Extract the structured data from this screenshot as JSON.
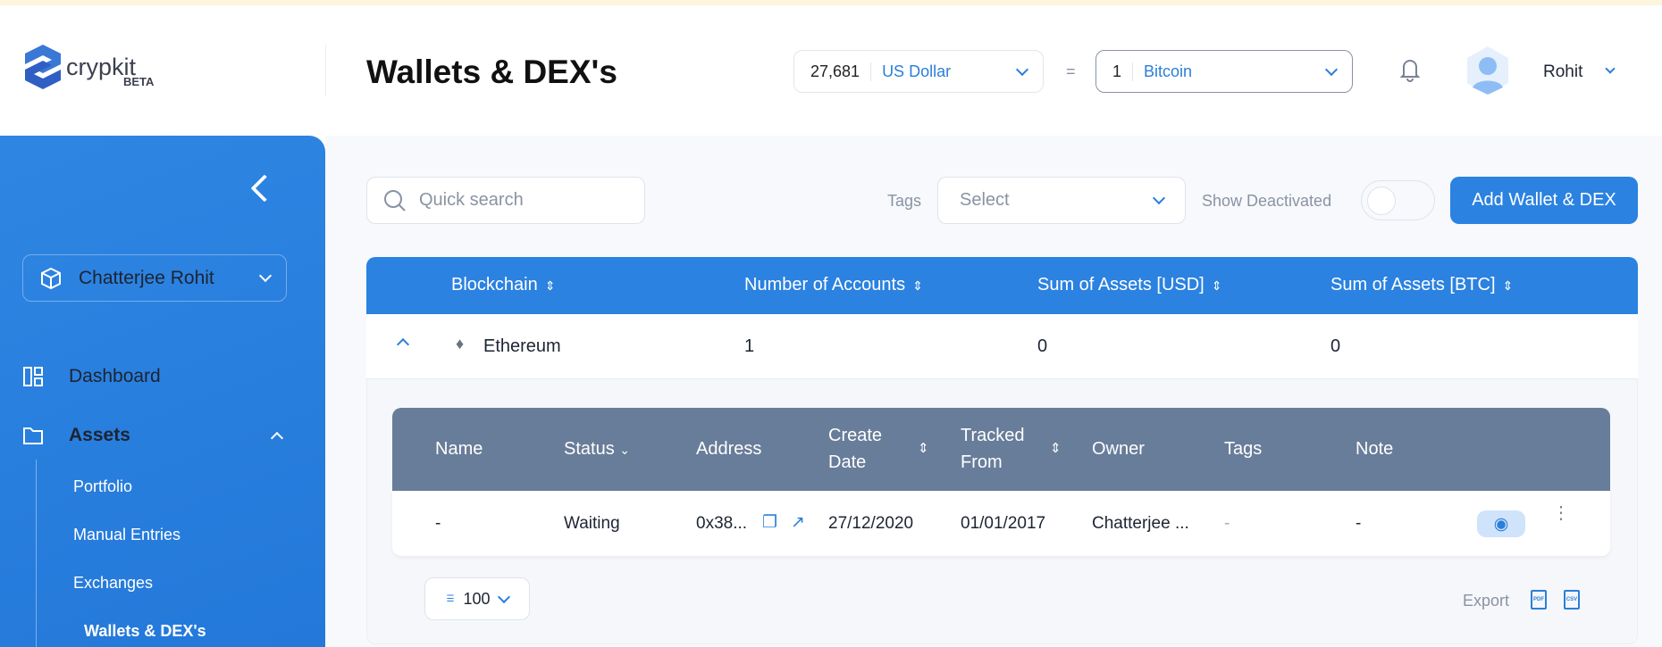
{
  "header": {
    "logo_text": "crypkit",
    "logo_badge": "BETA",
    "title": "Wallets & DEX's",
    "converter": {
      "from_amount": "27,681",
      "from_currency": "US Dollar",
      "equals": "=",
      "to_amount": "1",
      "to_currency": "Bitcoin"
    },
    "user_name": "Rohit"
  },
  "sidebar": {
    "org": "Chatterjee Rohit",
    "items": [
      {
        "label": "Dashboard"
      },
      {
        "label": "Assets"
      }
    ],
    "sub_items": [
      {
        "label": "Portfolio"
      },
      {
        "label": "Manual Entries"
      },
      {
        "label": "Exchanges"
      },
      {
        "label": "Wallets & DEX's"
      }
    ]
  },
  "toolbar": {
    "search_placeholder": "Quick search",
    "tags_label": "Tags",
    "tags_placeholder": "Select",
    "show_deactivated": "Show Deactivated",
    "show_deactivated_on": false,
    "add_button": "Add Wallet & DEX"
  },
  "table": {
    "columns": [
      "Blockchain",
      "Number of Accounts",
      "Sum of Assets [USD]",
      "Sum of Assets [BTC]"
    ],
    "rows": [
      {
        "blockchain": "Ethereum",
        "accounts": "1",
        "sum_usd": "0",
        "sum_btc": "0"
      }
    ]
  },
  "subtable": {
    "columns": {
      "name": "Name",
      "status": "Status",
      "address": "Address",
      "create1": "Create",
      "create2": "Date",
      "tracked1": "Tracked",
      "tracked2": "From",
      "owner": "Owner",
      "tags": "Tags",
      "note": "Note"
    },
    "rows": [
      {
        "name": "-",
        "status": "Waiting",
        "address": "0x38...",
        "create_date": "27/12/2020",
        "tracked_from": "01/01/2017",
        "owner": "Chatterjee ...",
        "tags": "-",
        "note": "-"
      }
    ]
  },
  "footer": {
    "page_size": "100",
    "export_label": "Export",
    "pdf": "PDF",
    "csv": "CSV"
  },
  "colors": {
    "accent": "#2b82e0",
    "subheader": "#687d99"
  }
}
